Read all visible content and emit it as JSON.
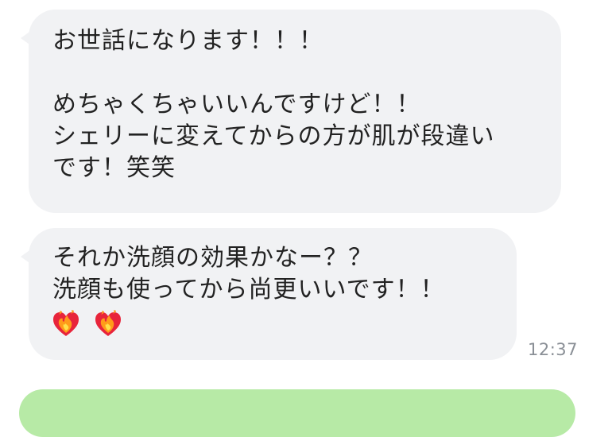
{
  "messages": [
    {
      "lines": [
        "お世話になります！！！",
        "",
        "めちゃくちゃいいんですけど！！",
        "シェリーに変えてからの方が肌が段違い",
        "です！笑笑"
      ]
    },
    {
      "lines": [
        "それか洗顔の効果かなー？？",
        "洗顔も使ってから尚更いいです！！"
      ],
      "emojis": [
        "heart-on-fire-icon",
        "heart-on-fire-icon"
      ],
      "time": "12:37"
    }
  ],
  "colors": {
    "incoming_bubble": "#f1f2f4",
    "outgoing_bubble": "#b7eaa6",
    "timestamp": "#8a8f96"
  }
}
